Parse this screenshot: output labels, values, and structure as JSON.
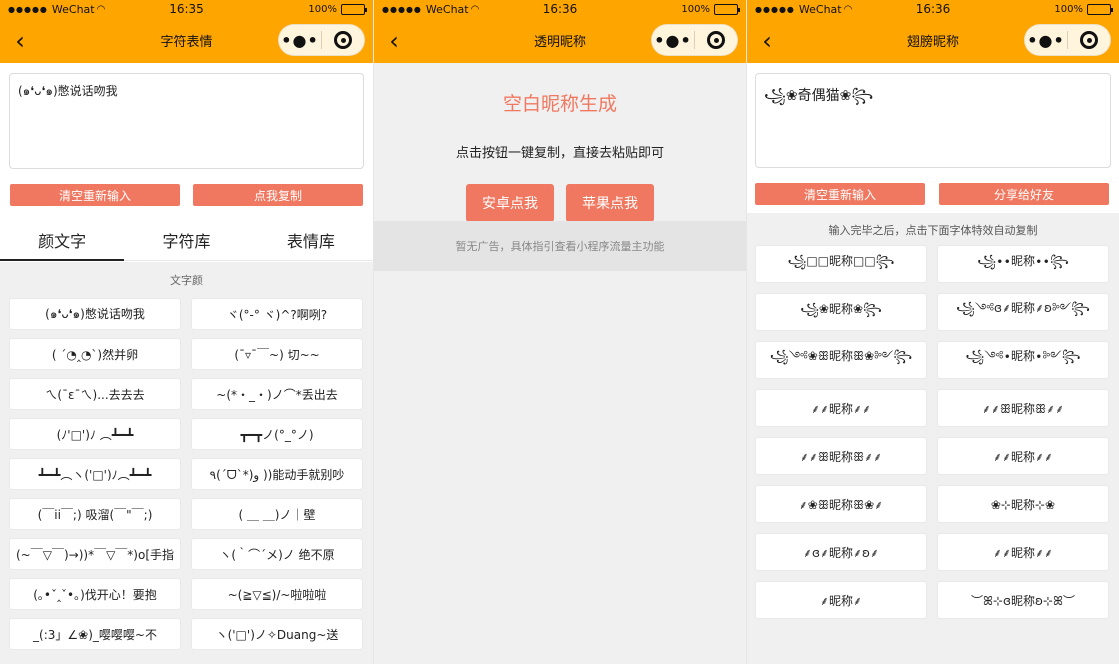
{
  "status": {
    "signal": "●●●●●",
    "carrier": "WeChat",
    "wifi_icon": "wifi-icon",
    "battery": "100%",
    "battery_level": 1.0
  },
  "phone1": {
    "time": "16:35",
    "title": "字符表情",
    "input_value": "(๑❛ᴗ❛๑)憋说话吻我",
    "buttons": {
      "clear": "清空重新输入",
      "copy": "点我复制"
    },
    "tabs": [
      "颜文字",
      "字符库",
      "表情库"
    ],
    "section_title": "文字颜",
    "items": [
      "(๑❛ᴗ❛๑)憋说话吻我",
      "ヾ(°-° ヾ)^?啊咧?",
      "( ´◔‸◔`)然并卵",
      "(¯▿¯￣~) 切~~",
      "ㄟ(¯ε¯ㄟ)...去去去",
      "~(*・_・)ノ⌒*丢出去",
      "(ﾉ'□')ﾉ ︵┻━┻",
      "┳━┳ノ(°_°ノ)",
      "┻━┻︵ヽ('□')ﾉ︵┻━┻",
      "٩(ˊᗜˋ*)و ))能动手就别吵",
      "(￣ii￣;) 吸溜(￣\"￣;)",
      "( ＿ ＿)ノ｜壁",
      "(~￣▽￣)→))*￣▽￣*)o[手指",
      "ヽ(｀⌒´メ)ノ 绝不原",
      "(｡•ˇ‸ˇ•｡)伐开心！要抱",
      "~(≧▽≦)/~啦啦啦",
      "_(:3」∠❀)_嘤嘤嘤~不",
      "ヽ('□')ノ✧Duang~送"
    ]
  },
  "phone2": {
    "time": "16:36",
    "title": "透明昵称",
    "heading": "空白昵称生成",
    "subtitle": "点击按钮一键复制，直接去粘贴即可",
    "buttons": {
      "android": "安卓点我",
      "apple": "苹果点我"
    },
    "ad_text": "暂无广告，具体指引查看小程序流量主功能"
  },
  "phone3": {
    "time": "16:36",
    "title": "翅膀昵称",
    "input_value": "꧁❀奇偶猫❀꧂",
    "buttons": {
      "clear": "清空重新输入",
      "share": "分享给好友"
    },
    "hint": "输入完毕之后，点击下面字体特效自动复制",
    "items": [
      "꧁□□昵称□□꧂",
      "꧁∙∙昵称∙∙꧂",
      "꧁❀昵称❀꧂",
      "꧁༺ɞ⸙昵称⸙ʚ༻꧂",
      "꧁༺❀ꕥ昵称ꕥ❀༻꧂",
      "꧁༺∙昵称∙༻꧂",
      "⸙⸙昵称⸙⸙",
      "⸙⸙ꕥ昵称ꕥ⸙⸙",
      "⸙⸙ꕥ昵称ꕥ⸙⸙",
      "⸙⸙昵称⸙⸙",
      "⸙❀ꕥ昵称ꕥ❀⸙",
      "❀⊹昵称⊹❀",
      "⸙ɞ⸙昵称⸙ʚ⸙",
      "⸙⸙昵称⸙⸙",
      "⸙昵称⸙",
      "︶ꕤ⊹ɞ昵称ʚ⊹ꕤ︶"
    ]
  }
}
